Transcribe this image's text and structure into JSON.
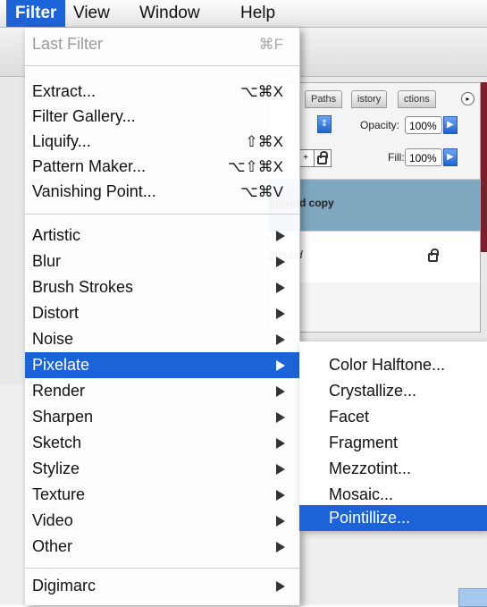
{
  "menubar": {
    "items": [
      "Filter",
      "View",
      "Window",
      "Help"
    ]
  },
  "panel": {
    "tabs": [
      "Paths",
      "istory",
      "ctions"
    ],
    "opacity_label": "Opacity:",
    "opacity_value": "100%",
    "fill_label": "Fill:",
    "fill_value": "100%",
    "layers": [
      "ground copy",
      "ground"
    ]
  },
  "filter_menu": {
    "items": [
      {
        "label": "Last Filter",
        "shortcut": "⌘F",
        "disabled": true
      },
      {
        "label": "Extract...",
        "shortcut": "⌥⌘X"
      },
      {
        "label": "Filter Gallery...",
        "shortcut": ""
      },
      {
        "label": "Liquify...",
        "shortcut": "⇧⌘X"
      },
      {
        "label": "Pattern Maker...",
        "shortcut": "⌥⇧⌘X"
      },
      {
        "label": "Vanishing Point...",
        "shortcut": "⌥⌘V"
      },
      {
        "label": "Artistic",
        "submenu": true
      },
      {
        "label": "Blur",
        "submenu": true
      },
      {
        "label": "Brush Strokes",
        "submenu": true
      },
      {
        "label": "Distort",
        "submenu": true
      },
      {
        "label": "Noise",
        "submenu": true
      },
      {
        "label": "Pixelate",
        "submenu": true,
        "highlighted": true
      },
      {
        "label": "Render",
        "submenu": true
      },
      {
        "label": "Sharpen",
        "submenu": true
      },
      {
        "label": "Sketch",
        "submenu": true
      },
      {
        "label": "Stylize",
        "submenu": true
      },
      {
        "label": "Texture",
        "submenu": true
      },
      {
        "label": "Video",
        "submenu": true
      },
      {
        "label": "Other",
        "submenu": true
      },
      {
        "label": "Digimarc",
        "submenu": true
      }
    ]
  },
  "pixelate_submenu": {
    "items": [
      "Color Halftone...",
      "Crystallize...",
      "Facet",
      "Fragment",
      "Mezzotint...",
      "Mosaic...",
      "Pointillize..."
    ],
    "highlighted": "Pointillize..."
  },
  "colors": {
    "highlight": "#1c63d8",
    "selected_layer": "#7fa8c0"
  }
}
